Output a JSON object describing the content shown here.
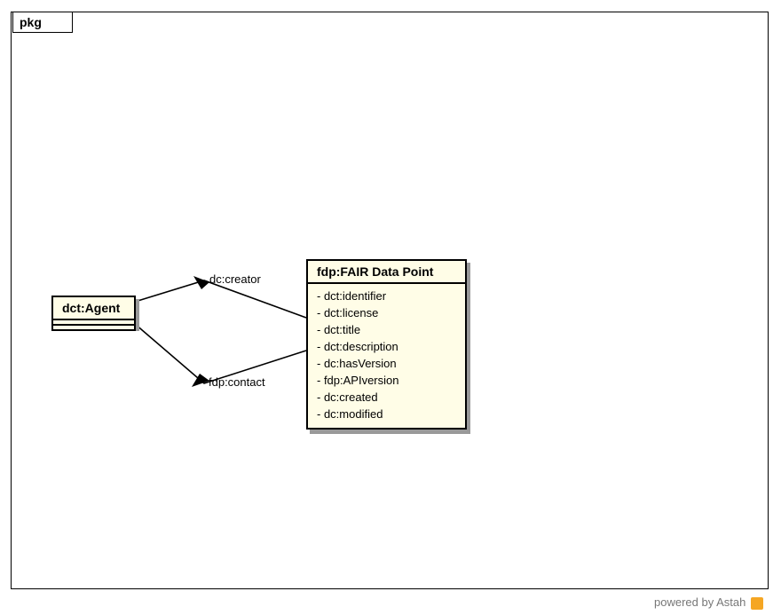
{
  "package": {
    "label": "pkg"
  },
  "classes": {
    "agent": {
      "title": "dct:Agent",
      "attributes": []
    },
    "fdp": {
      "title": "fdp:FAIR Data Point",
      "attributes": [
        "- dct:identifier",
        "- dct:license",
        "- dct:title",
        "- dct:description",
        "- dc:hasVersion",
        "- fdp:APIversion",
        "- dc:created",
        "- dc:modified"
      ]
    }
  },
  "relations": {
    "creator": {
      "label": "dc:creator"
    },
    "contact": {
      "label": "fdp:contact"
    }
  },
  "footer": {
    "text": "powered by Astah"
  },
  "chart_data": {
    "type": "uml-class-diagram",
    "package": "pkg",
    "classes": [
      {
        "name": "dct:Agent",
        "attributes": []
      },
      {
        "name": "fdp:FAIR Data Point",
        "attributes": [
          "dct:identifier",
          "dct:license",
          "dct:title",
          "dct:description",
          "dc:hasVersion",
          "fdp:APIversion",
          "dc:created",
          "dc:modified"
        ]
      }
    ],
    "associations": [
      {
        "from": "fdp:FAIR Data Point",
        "to": "dct:Agent",
        "label": "dc:creator",
        "navigable_to": "dct:Agent"
      },
      {
        "from": "fdp:FAIR Data Point",
        "to": "dct:Agent",
        "label": "fdp:contact",
        "navigable_to": "dct:Agent"
      }
    ]
  }
}
